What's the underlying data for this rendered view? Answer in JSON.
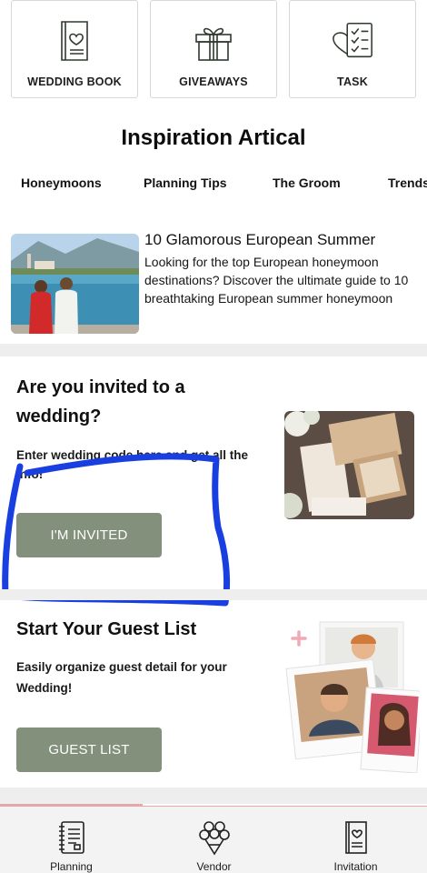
{
  "top_cards": [
    {
      "label": "WEDDING BOOK",
      "icon": "wedding-book-icon"
    },
    {
      "label": "GIVEAWAYS",
      "icon": "gift-icon"
    },
    {
      "label": "TASK",
      "icon": "task-checklist-icon"
    }
  ],
  "inspiration": {
    "title": "Inspiration Artical",
    "tabs": [
      "Honeymoons",
      "Planning Tips",
      "The Groom",
      "Trends"
    ],
    "article": {
      "title": "10 Glamorous European Summer",
      "description": "Looking for the top European honeymoon destinations? Discover the ultimate guide to 10 breathtaking European summer honeymoon"
    }
  },
  "invite": {
    "title": "Are you invited to a wedding?",
    "subtitle": "Enter wedding code here and get all the info!",
    "button_label": "I'M INVITED"
  },
  "guest_list": {
    "title": "Start Your Guest List",
    "subtitle": "Easily organize guest detail for your Wedding!",
    "button_label": "GUEST LIST"
  },
  "bottom_nav": {
    "items": [
      {
        "label": "Planning",
        "icon": "planner-notebook-icon"
      },
      {
        "label": "Vendor",
        "icon": "bouquet-icon"
      },
      {
        "label": "Invitation",
        "icon": "invitation-card-icon"
      }
    ],
    "active_index": 0
  },
  "colors": {
    "button": "#83907c",
    "accent": "#e9a5ae",
    "divider": "#eeeeee",
    "annotation_scribble": "#1a3fe0"
  }
}
